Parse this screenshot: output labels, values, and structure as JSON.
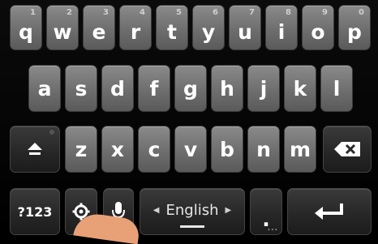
{
  "keyboard": {
    "row1": [
      {
        "letter": "q",
        "hint": "1"
      },
      {
        "letter": "w",
        "hint": "2"
      },
      {
        "letter": "e",
        "hint": "3"
      },
      {
        "letter": "r",
        "hint": "4"
      },
      {
        "letter": "t",
        "hint": "5"
      },
      {
        "letter": "y",
        "hint": "6"
      },
      {
        "letter": "u",
        "hint": "7"
      },
      {
        "letter": "i",
        "hint": "8"
      },
      {
        "letter": "o",
        "hint": "9"
      },
      {
        "letter": "p",
        "hint": "0"
      }
    ],
    "row2": [
      "a",
      "s",
      "d",
      "f",
      "g",
      "h",
      "j",
      "k",
      "l"
    ],
    "row3": [
      "z",
      "x",
      "c",
      "v",
      "b",
      "n",
      "m"
    ],
    "symbols_label": "?123",
    "space_label": "English",
    "period_label": ".",
    "dots_label": "...",
    "icons": {
      "shift": "shift-arrow-icon",
      "backspace": "backspace-icon",
      "settings": "gear-icon",
      "voice": "microphone-icon",
      "enter": "enter-return-icon"
    }
  }
}
